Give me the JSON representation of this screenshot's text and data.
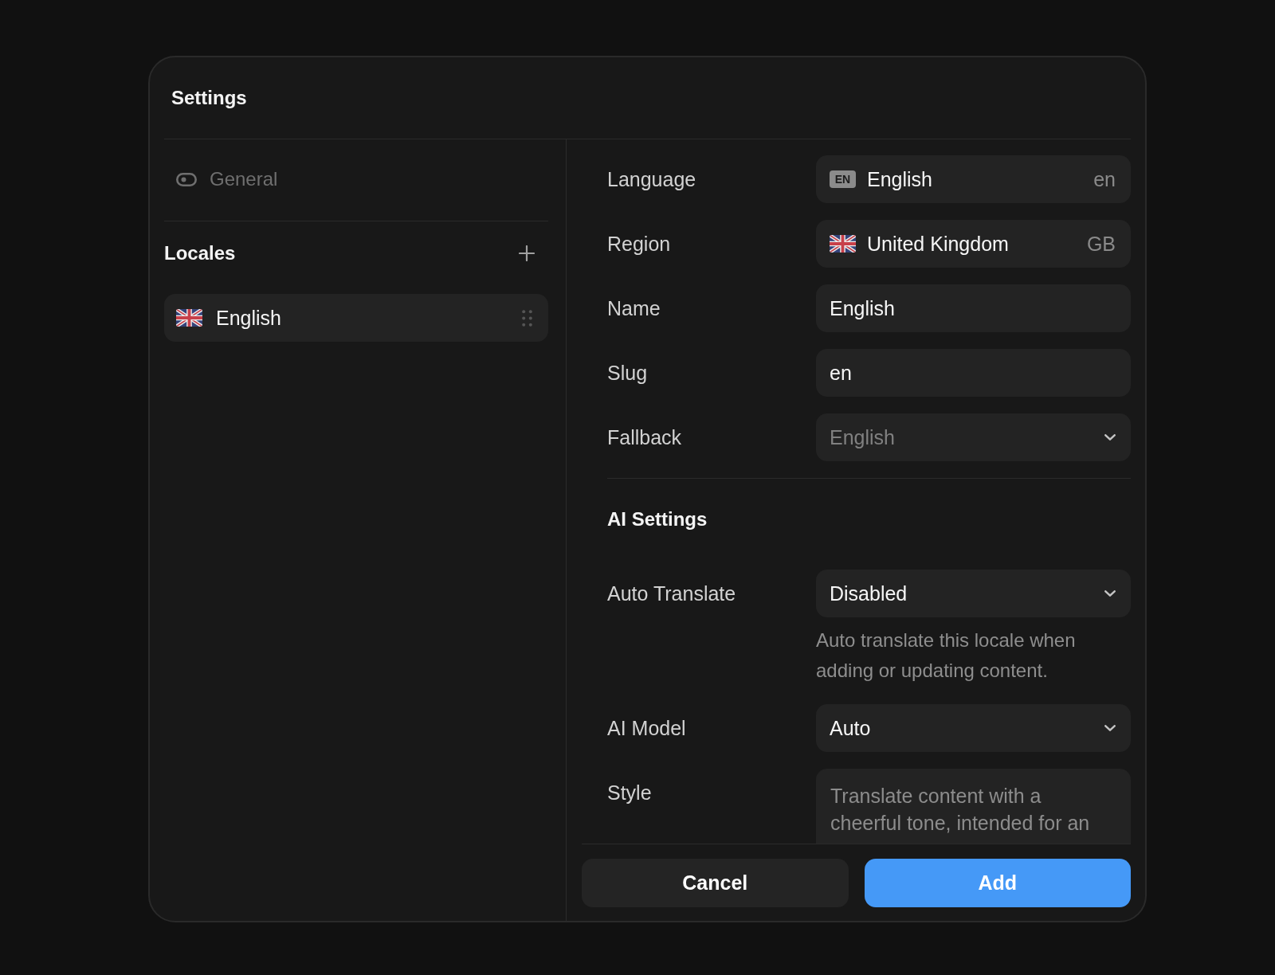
{
  "dialog": {
    "title": "Settings"
  },
  "sidebar": {
    "nav": [
      {
        "label": "General",
        "selected": false
      }
    ],
    "locales": {
      "title": "Locales",
      "items": [
        {
          "name": "English",
          "selected": true
        }
      ]
    }
  },
  "form": {
    "fields": [
      {
        "kind": "language",
        "label": "Language",
        "badge": "EN",
        "value": "English",
        "code": "en"
      },
      {
        "kind": "region",
        "label": "Region",
        "value": "United Kingdom",
        "code": "GB"
      },
      {
        "kind": "text",
        "label": "Name",
        "value": "English"
      },
      {
        "kind": "text",
        "label": "Slug",
        "value": "en"
      },
      {
        "kind": "select",
        "label": "Fallback",
        "placeholder": "English"
      }
    ],
    "ai_section": {
      "title": "AI Settings",
      "fields": [
        {
          "kind": "select",
          "label": "Auto Translate",
          "value": "Disabled",
          "help": "Auto translate this locale when adding or updating content."
        },
        {
          "kind": "select",
          "label": "AI Model",
          "value": "Auto"
        },
        {
          "kind": "textarea",
          "label": "Style",
          "placeholder": "Translate content with a cheerful tone, intended for an"
        }
      ]
    }
  },
  "footer": {
    "buttons": [
      {
        "label": "Cancel",
        "kind": "secondary"
      },
      {
        "label": "Add",
        "kind": "primary"
      }
    ]
  }
}
